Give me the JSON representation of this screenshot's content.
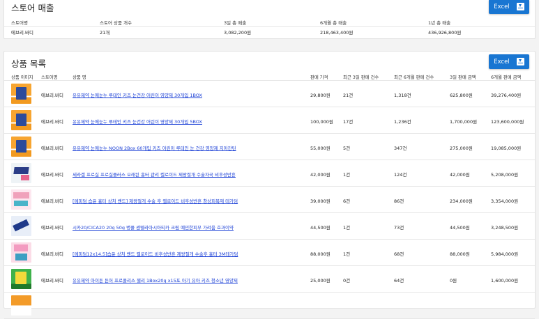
{
  "store_sales": {
    "title": "스토어 매출",
    "excel_label": "Excel",
    "headers": [
      "스토어명",
      "스토어 상품 개수",
      "3일 총 매출",
      "6개월 총 매출",
      "1년 총 매출"
    ],
    "row": [
      "에브리.바디",
      "21개",
      "3,082,200원",
      "218,463,400원",
      "436,926,800원"
    ]
  },
  "product_list": {
    "title": "상품 목록",
    "excel_label": "Excel",
    "headers": [
      "상품 이미지",
      "스토어명",
      "상품 명",
      "판매 가격",
      "최근 3일 판매 건수",
      "최근 6개월 판매 건수",
      "3일 판매 금액",
      "6개월 판매 금액"
    ],
    "rows": [
      {
        "thumb": "orange",
        "store": "에브리.바디",
        "name": "유유제약 눈에눈누 루테인 키즈 눈건강 어린이 영양제 30개입 1BOX",
        "price": "29,800원",
        "sales3d": "21건",
        "sales6m": "1,318건",
        "amount3d": "625,800원",
        "amount6m": "39,276,400원"
      },
      {
        "thumb": "orange",
        "store": "에브리.바디",
        "name": "유유제약 눈에눈누 루테인 키즈 눈건강 어린이 영양제 30개입 5BOX",
        "price": "100,000원",
        "sales3d": "17건",
        "sales6m": "1,236건",
        "amount3d": "1,700,000원",
        "amount6m": "123,600,000원"
      },
      {
        "thumb": "orange",
        "store": "에브리.바디",
        "name": "유유제약 눈에눈누 NOON 2Box 60개입 키즈 어린이 루테인 눈 건강 영양제 지아잔틴",
        "price": "55,000원",
        "sales3d": "5건",
        "sales6m": "347건",
        "amount3d": "275,000원",
        "amount6m": "19,085,000원"
      },
      {
        "thumb": "cream",
        "store": "에브리.바디",
        "name": "세라겔 프로실 프로실플러스 오래된 흉터 관리 켈로이드 제왕절개 수술자국 비후성반흔",
        "price": "42,000원",
        "sales3d": "1건",
        "sales6m": "124건",
        "amount3d": "42,000원",
        "amount6m": "5,208,000원"
      },
      {
        "thumb": "pink",
        "store": "에브리.바디",
        "name": "[메피덤 습윤 흉터 상처 밴드] 제왕절개 수술 후 켈로이드 비후성반흔 창상피복재 테가덤",
        "price": "39,000원",
        "sales3d": "6건",
        "sales6m": "86건",
        "amount3d": "234,000원",
        "amount6m": "3,354,000원"
      },
      {
        "thumb": "blue",
        "store": "에브리.바디",
        "name": "시카20/CICA20 20g 50g 병풀 센텔라아시아티카 크림 예민한피부 가려움 효과이약",
        "price": "44,500원",
        "sales3d": "1건",
        "sales6m": "73건",
        "amount3d": "44,500원",
        "amount6m": "3,248,500원"
      },
      {
        "thumb": "pink2",
        "store": "에브리.바디",
        "name": "[메피덤12x14.5]습윤 상처 밴드 켈로이드 비후성반흔 제왕절개 수술후 흉터 3M테가덤",
        "price": "88,000원",
        "sales3d": "1건",
        "sales6m": "68건",
        "amount3d": "88,000원",
        "amount6m": "5,984,000원"
      },
      {
        "thumb": "green",
        "store": "에브리.바디",
        "name": "유유제약 아이튼 튼어 프로폴리스 젤리 1Box20g x15포 아기 유아 키즈 청소년 영양제",
        "price": "25,000원",
        "sales3d": "0건",
        "sales6m": "64건",
        "amount3d": "0원",
        "amount6m": "1,600,000원"
      }
    ]
  },
  "colors": {
    "accent": "#1976d2",
    "link": "#1a3fd6"
  }
}
